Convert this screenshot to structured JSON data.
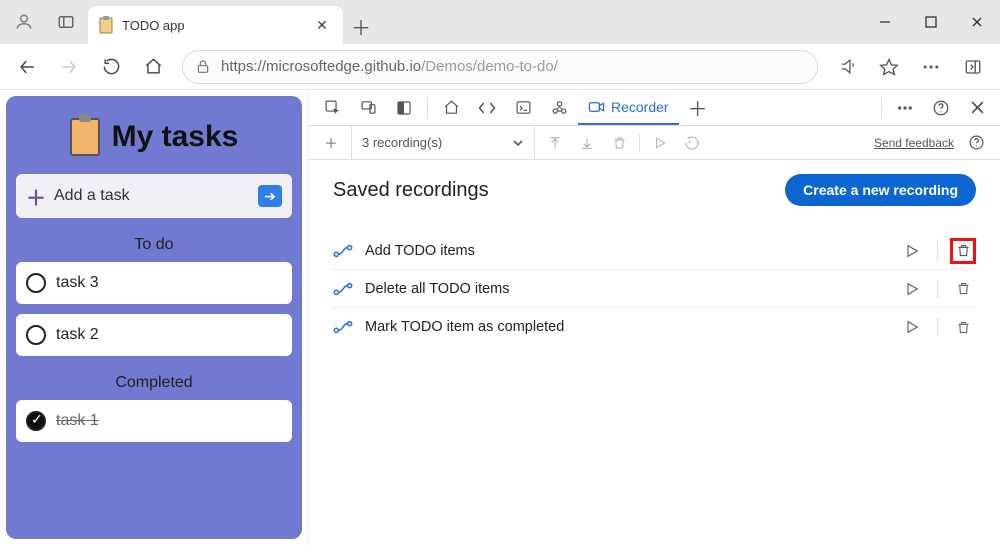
{
  "browser": {
    "tab_title": "TODO app",
    "url_host": "https://microsoftedge.github.io",
    "url_path": "/Demos/demo-to-do/"
  },
  "app": {
    "title": "My tasks",
    "add_task_label": "Add a task",
    "sections": {
      "todo_label": "To do",
      "completed_label": "Completed"
    },
    "todo_items": [
      {
        "label": "task 3"
      },
      {
        "label": "task 2"
      }
    ],
    "completed_items": [
      {
        "label": "task 1"
      }
    ]
  },
  "devtools": {
    "recorder_tab_label": "Recorder",
    "recordings_count_label": "3 recording(s)",
    "send_feedback_label": "Send feedback",
    "saved_title": "Saved recordings",
    "create_button_label": "Create a new recording",
    "recordings": [
      {
        "name": "Add TODO items",
        "highlighted_delete": true
      },
      {
        "name": "Delete all TODO items",
        "highlighted_delete": false
      },
      {
        "name": "Mark TODO item as completed",
        "highlighted_delete": false
      }
    ]
  }
}
